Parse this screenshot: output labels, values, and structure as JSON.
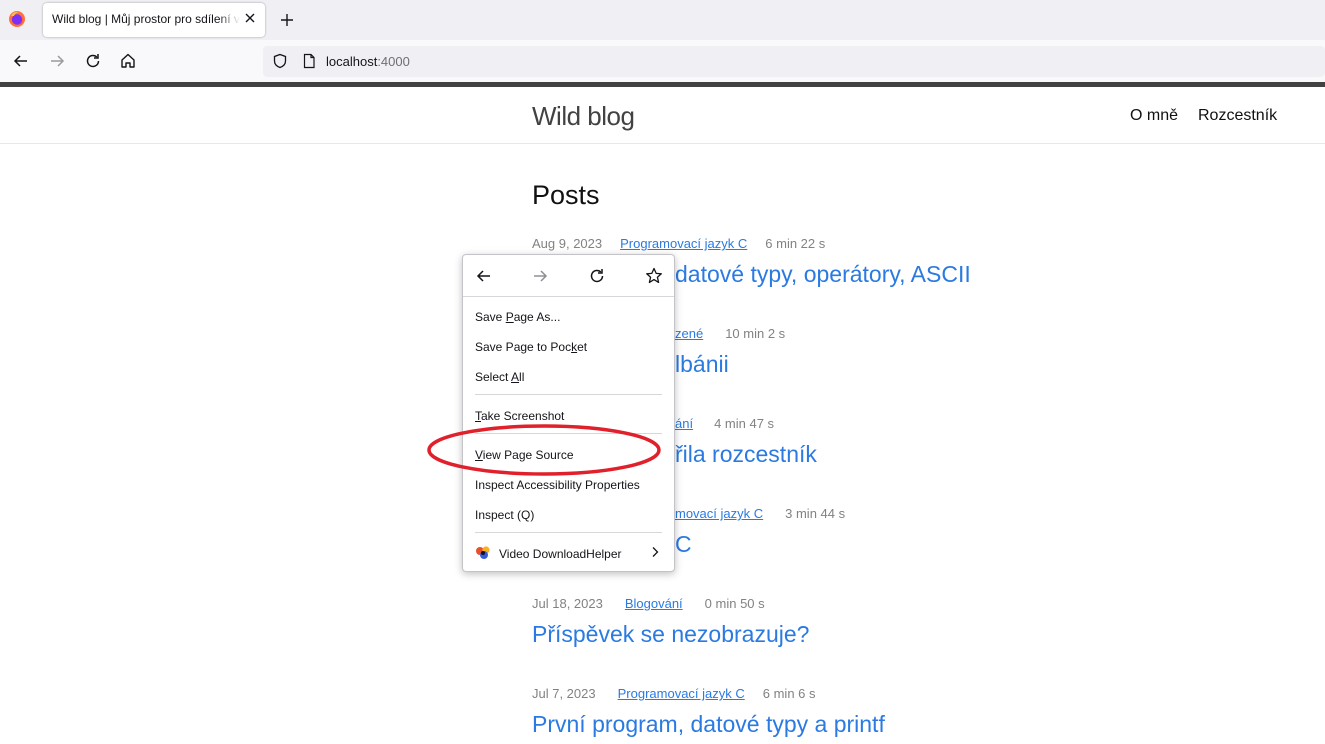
{
  "browser": {
    "tab_title": "Wild blog | Můj prostor pro sdílení v",
    "url_host": "localhost",
    "url_port": ":4000"
  },
  "site": {
    "title": "Wild blog",
    "nav": [
      "O mně",
      "Rozcestník"
    ]
  },
  "page": {
    "heading": "Posts",
    "posts": [
      {
        "date": "Aug 9, 2023",
        "category": "Programovací jazyk C",
        "reading_time": "6 min 22 s",
        "title": "datové typy, operátory, ASCII"
      },
      {
        "date": "",
        "category": "zené",
        "reading_time": "10 min 2 s",
        "title": "lbánii"
      },
      {
        "date": "",
        "category": "ání",
        "reading_time": "4 min 47 s",
        "title": "řila rozcestník"
      },
      {
        "date": "",
        "category": "movací jazyk C",
        "reading_time": "3 min 44 s",
        "title": "C"
      },
      {
        "date": "Jul 18, 2023",
        "category": "Blogování",
        "reading_time": "0 min 50 s",
        "title": "Příspěvek se nezobrazuje?"
      },
      {
        "date": "Jul 7, 2023",
        "category": "Programovací jazyk C",
        "reading_time": "6 min 6 s",
        "title": "První program, datové typy a printf"
      }
    ]
  },
  "context_menu": {
    "save_page_as": {
      "before": "Save ",
      "accel": "P",
      "after": "age As..."
    },
    "save_to_pocket": {
      "before": "Save Page to Poc",
      "accel": "k",
      "after": "et"
    },
    "select_all": {
      "before": "Select ",
      "accel": "A",
      "after": "ll"
    },
    "take_screenshot": {
      "before": "",
      "accel": "T",
      "after": "ake Screenshot"
    },
    "view_page_source": {
      "before": "",
      "accel": "V",
      "after": "iew Page Source"
    },
    "inspect_accessibility": "Inspect Accessibility Properties",
    "inspect": "Inspect (Q)",
    "video_downloadhelper": "Video DownloadHelper"
  },
  "colors": {
    "link": "#2a7ae2",
    "meta": "#828282",
    "highlight": "#e0202a"
  },
  "icons": [
    "firefox-logo-icon",
    "close-icon",
    "plus-icon",
    "back-arrow-icon",
    "forward-arrow-icon",
    "reload-icon",
    "home-icon",
    "shield-icon",
    "page-icon",
    "bookmark-star-icon",
    "video-downloadhelper-icon",
    "chevron-right-icon"
  ]
}
